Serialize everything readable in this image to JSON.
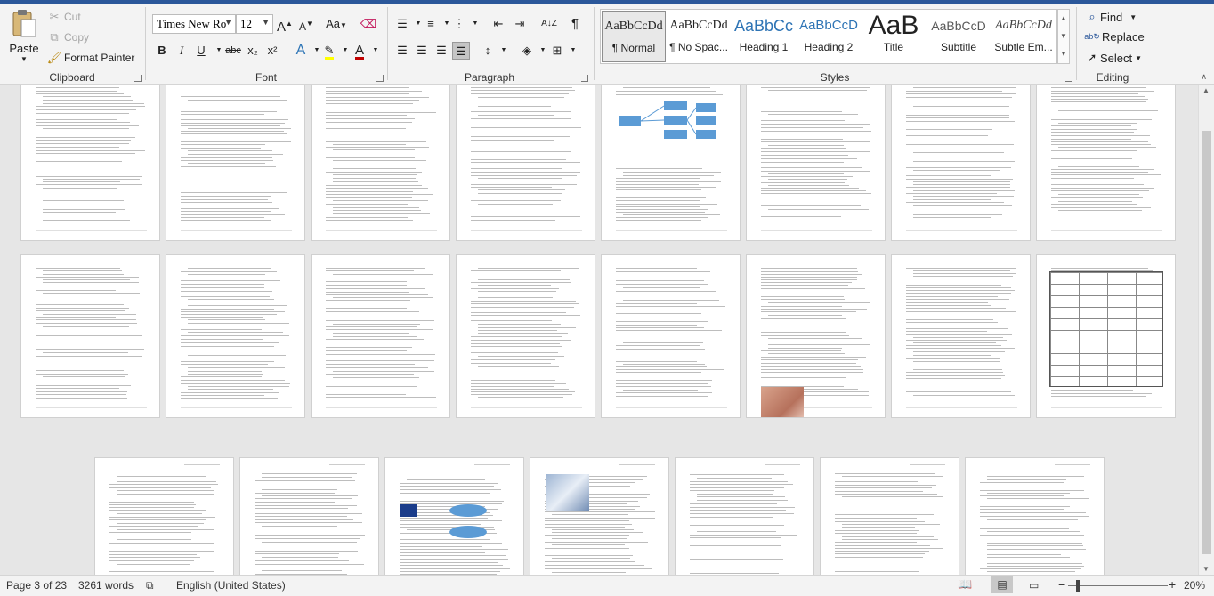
{
  "ribbon": {
    "clipboard": {
      "label": "Clipboard",
      "paste": "Paste",
      "cut": "Cut",
      "copy": "Copy",
      "format_painter": "Format Painter"
    },
    "font": {
      "label": "Font",
      "font_name": "Times New Ro",
      "font_size": "12",
      "grow": "A",
      "shrink": "A",
      "change_case": "Aa",
      "bold": "B",
      "italic": "I",
      "underline": "U",
      "strikethrough": "abc",
      "subscript": "x₂",
      "superscript": "x²",
      "text_effects": "A",
      "font_color": "A"
    },
    "paragraph": {
      "label": "Paragraph",
      "sort": "A↓Z",
      "show_marks": "¶"
    },
    "styles": {
      "label": "Styles",
      "items": [
        {
          "preview": "AaBbCcDd",
          "name": "¶ Normal"
        },
        {
          "preview": "AaBbCcDd",
          "name": "¶ No Spac..."
        },
        {
          "preview": "AaBbCc",
          "name": "Heading 1"
        },
        {
          "preview": "AaBbCcD",
          "name": "Heading 2"
        },
        {
          "preview": "AaB",
          "name": "Title"
        },
        {
          "preview": "AaBbCcD",
          "name": "Subtitle"
        },
        {
          "preview": "AaBbCcDd",
          "name": "Subtle Em..."
        }
      ]
    },
    "editing": {
      "label": "Editing",
      "find": "Find",
      "replace": "Replace",
      "select": "Select"
    }
  },
  "status": {
    "page": "Page 3 of 23",
    "words": "3261 words",
    "language": "English (United States)",
    "zoom": "20%"
  },
  "colors": {
    "accent": "#2b579a",
    "highlight": "#ffff00",
    "font_color": "#c00000",
    "diagram_blue": "#5b9bd5"
  }
}
